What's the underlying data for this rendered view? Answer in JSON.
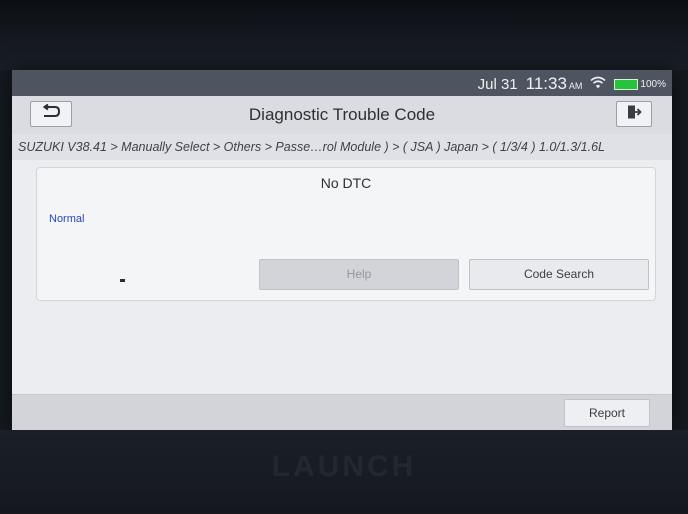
{
  "status_bar": {
    "date": "Jul 31",
    "time": "11:33",
    "ampm": "AM",
    "battery_percent": "100%",
    "battery_level": 1.0,
    "wifi_icon": "wifi-icon"
  },
  "header": {
    "title": "Diagnostic Trouble Code",
    "back_icon": "back-arrow-icon",
    "exit_icon": "exit-icon"
  },
  "breadcrumb": "SUZUKI V38.41 > Manually Select > Others > Passe…rol Module ) > ( JSA ) Japan > ( 1/3/4 ) 1.0/1.3/1.6L",
  "dtc_panel": {
    "title": "No DTC",
    "status": "Normal",
    "help_label": "Help",
    "code_search_label": "Code Search"
  },
  "footer": {
    "report_label": "Report"
  },
  "device": {
    "brand": "LAUNCH"
  },
  "colors": {
    "status_bar_bg": "#4f5560",
    "screen_bg": "#ecedf1",
    "status_text": "#2b45b8",
    "battery_green": "#27c23c"
  }
}
